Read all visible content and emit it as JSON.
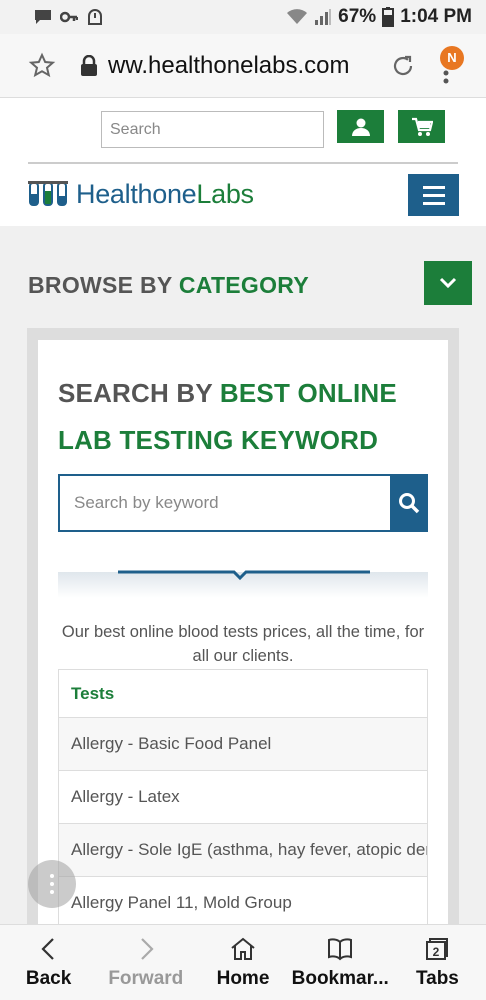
{
  "status_bar": {
    "battery": "67%",
    "time": "1:04 PM"
  },
  "browser": {
    "url": "ww.healthonelabs.com",
    "notification_badge": "N"
  },
  "header": {
    "search_placeholder": "Search",
    "logo_part1": "Healthone",
    "logo_part2": "Labs"
  },
  "browse": {
    "label_part1": "BROWSE BY ",
    "label_part2": "CATEGORY"
  },
  "keyword_section": {
    "title_part1": "SEARCH BY ",
    "title_part2": "BEST ONLINE LAB TESTING KEYWORD",
    "search_placeholder": "Search by keyword",
    "description": "Our best online blood tests prices, all the time, for all our clients."
  },
  "tests_table": {
    "header": "Tests",
    "rows": [
      "Allergy - Basic Food Panel",
      "Allergy - Latex",
      "Allergy - Sole IgE (asthma, hay fever, atopic dermatitis)",
      "Allergy Panel 11, Mold Group"
    ]
  },
  "bottom_nav": {
    "back": "Back",
    "forward": "Forward",
    "home": "Home",
    "bookmarks": "Bookmar...",
    "tabs": "Tabs",
    "tabs_count": "2"
  },
  "colors": {
    "brand_green": "#1c7e3a",
    "brand_blue": "#1e5f8b"
  }
}
